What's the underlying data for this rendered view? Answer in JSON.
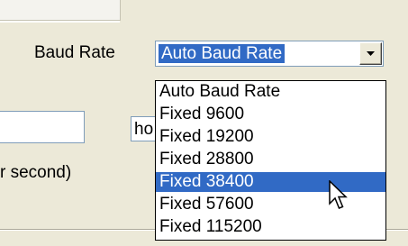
{
  "baud_rate": {
    "label": "Baud Rate",
    "selected_value": "Auto Baud Rate",
    "options": [
      {
        "label": "Auto Baud Rate",
        "highlighted": false
      },
      {
        "label": "Fixed 9600",
        "highlighted": false
      },
      {
        "label": "Fixed 19200",
        "highlighted": false
      },
      {
        "label": "Fixed 28800",
        "highlighted": false
      },
      {
        "label": "Fixed 38400",
        "highlighted": true
      },
      {
        "label": "Fixed 57600",
        "highlighted": false
      },
      {
        "label": "Fixed 115200",
        "highlighted": false
      }
    ]
  },
  "left_input": {
    "value": ""
  },
  "unit_input": {
    "value": "ho"
  },
  "units_label": "r second)",
  "colors": {
    "panel_bg": "#ece9d8",
    "selection": "#316ac5",
    "input_border": "#7f9db9"
  },
  "icons": {
    "dropdown_arrow": "chevron-down-icon",
    "cursor": "mouse-pointer-icon"
  }
}
